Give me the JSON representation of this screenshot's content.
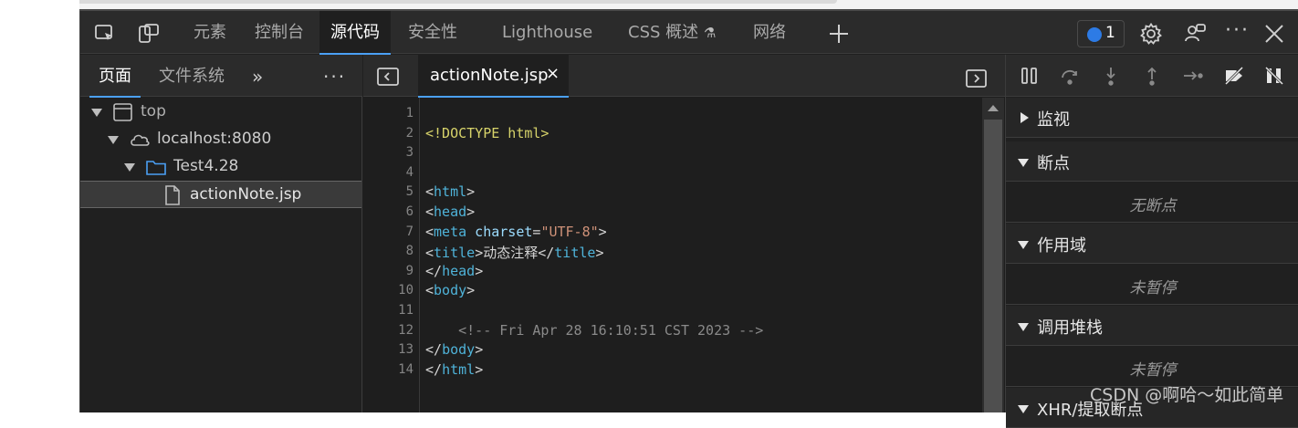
{
  "tabs": [
    {
      "label": "元素"
    },
    {
      "label": "控制台"
    },
    {
      "label": "源代码"
    },
    {
      "label": "安全性"
    },
    {
      "label": "Lighthouse"
    },
    {
      "label": "CSS 概述"
    },
    {
      "label": "网络"
    }
  ],
  "active_tab": "源代码",
  "issues_count": "1",
  "navigator": {
    "tabs": [
      "页面",
      "文件系统"
    ],
    "tree": [
      {
        "label": "top"
      },
      {
        "label": "localhost:8080"
      },
      {
        "label": "Test4.28"
      },
      {
        "label": "actionNote.jsp"
      }
    ]
  },
  "editor": {
    "file_tab": "actionNote.jsp",
    "close_glyph": "×",
    "line_numbers": [
      "1",
      "2",
      "3",
      "4",
      "5",
      "6",
      "7",
      "8",
      "9",
      "10",
      "11",
      "12",
      "13",
      "14"
    ],
    "lines": [
      {
        "segments": []
      },
      {
        "segments": [
          {
            "t": "<!DOCTYPE html>",
            "c": "doc"
          }
        ]
      },
      {
        "segments": []
      },
      {
        "segments": []
      },
      {
        "segments": [
          {
            "t": "<",
            "c": "txt"
          },
          {
            "t": "html",
            "c": "tag"
          },
          {
            "t": ">",
            "c": "txt"
          }
        ]
      },
      {
        "segments": [
          {
            "t": "<",
            "c": "txt"
          },
          {
            "t": "head",
            "c": "tag"
          },
          {
            "t": ">",
            "c": "txt"
          }
        ]
      },
      {
        "segments": [
          {
            "t": "<",
            "c": "txt"
          },
          {
            "t": "meta",
            "c": "tag"
          },
          {
            "t": " charset",
            "c": "attr"
          },
          {
            "t": "=",
            "c": "txt"
          },
          {
            "t": "\"UTF-8\"",
            "c": "str"
          },
          {
            "t": ">",
            "c": "txt"
          }
        ]
      },
      {
        "segments": [
          {
            "t": "<",
            "c": "txt"
          },
          {
            "t": "title",
            "c": "tag"
          },
          {
            "t": ">动态注释</",
            "c": "txt"
          },
          {
            "t": "title",
            "c": "tag"
          },
          {
            "t": ">",
            "c": "txt"
          }
        ]
      },
      {
        "segments": [
          {
            "t": "</",
            "c": "txt"
          },
          {
            "t": "head",
            "c": "tag"
          },
          {
            "t": ">",
            "c": "txt"
          }
        ]
      },
      {
        "segments": [
          {
            "t": "<",
            "c": "txt"
          },
          {
            "t": "body",
            "c": "tag"
          },
          {
            "t": ">",
            "c": "txt"
          }
        ]
      },
      {
        "segments": []
      },
      {
        "segments": [
          {
            "t": "    <!-- Fri Apr 28 16:10:51 CST 2023 -->",
            "c": "cmt"
          }
        ]
      },
      {
        "segments": [
          {
            "t": "</",
            "c": "txt"
          },
          {
            "t": "body",
            "c": "tag"
          },
          {
            "t": ">",
            "c": "txt"
          }
        ]
      },
      {
        "segments": [
          {
            "t": "</",
            "c": "txt"
          },
          {
            "t": "html",
            "c": "tag"
          },
          {
            "t": ">",
            "c": "txt"
          }
        ]
      }
    ]
  },
  "debugger": {
    "sections": [
      {
        "title": "监视",
        "expanded": false,
        "empty": ""
      },
      {
        "title": "断点",
        "expanded": true,
        "empty": "无断点"
      },
      {
        "title": "作用域",
        "expanded": true,
        "empty": "未暂停"
      },
      {
        "title": "调用堆栈",
        "expanded": true,
        "empty": "未暂停"
      },
      {
        "title": "XHR/提取断点",
        "expanded": true,
        "empty": ""
      }
    ]
  },
  "watermark": "CSDN @啊哈～如此简单",
  "colors": {
    "accent": "#4ba0f5",
    "issue_badge": "#2d7be5"
  }
}
